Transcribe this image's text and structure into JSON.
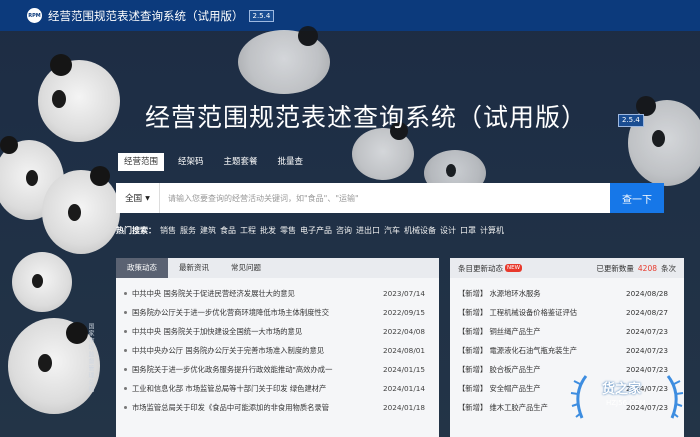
{
  "header": {
    "logo_text": "RPM",
    "title": "经营范围规范表述查询系统（试用版）",
    "version": "2.5.4"
  },
  "hero": {
    "title": "经营范围规范表述查询系统（试用版）",
    "version": "2.5.4"
  },
  "tabs": [
    {
      "label": "经营范围",
      "active": true
    },
    {
      "label": "经架码",
      "active": false
    },
    {
      "label": "主题套餐",
      "active": false
    },
    {
      "label": "批量查",
      "active": false
    }
  ],
  "search": {
    "scope_label": "全国",
    "placeholder": "请输入您要查询的经营活动关键词，如\"食品\"、\"运输\"",
    "button_label": "查一下"
  },
  "hot": {
    "label": "热门搜索：",
    "words": [
      "销售",
      "服务",
      "建筑",
      "食品",
      "工程",
      "批发",
      "零售",
      "电子产品",
      "咨询",
      "进出口",
      "汽车",
      "机械设备",
      "设计",
      "口罩",
      "计算机"
    ]
  },
  "news_panel": {
    "tabs": [
      {
        "label": "政策动态",
        "active": true
      },
      {
        "label": "最新资讯",
        "active": false
      },
      {
        "label": "常见问题",
        "active": false
      }
    ],
    "items": [
      {
        "title": "中共中央 国务院关于促进民营经济发展壮大的意见",
        "date": "2023/07/14"
      },
      {
        "title": "国务院办公厅关于进一步优化营商环境降低市场主体制度性交",
        "date": "2022/09/15"
      },
      {
        "title": "中共中央 国务院关于加快建设全国统一大市场的意见",
        "date": "2022/04/08"
      },
      {
        "title": "中共中央办公厅 国务院办公厅关于完善市场准入制度的意见",
        "date": "2024/08/01"
      },
      {
        "title": "国务院关于进一步优化政务服务提升行政效能推动\"高效办成一",
        "date": "2024/01/15"
      },
      {
        "title": "工业和信息化部 市场监管总局等十部门关于印发 绿色建材产",
        "date": "2024/01/14"
      },
      {
        "title": "市场监管总局关于印发《食品中可能添加的非食用物质名录管",
        "date": "2024/01/18"
      }
    ]
  },
  "updates_panel": {
    "title": "条目更新动态",
    "badge": "NEW",
    "count_label": "已更新数量",
    "count": "4208",
    "count_unit": "条次",
    "items": [
      {
        "title": "【新增】 水源地环水服务",
        "date": "2024/08/28"
      },
      {
        "title": "【新增】 工程机械设备价格鉴证评估",
        "date": "2024/08/27"
      },
      {
        "title": "【新增】 铜丝绳产品生产",
        "date": "2024/07/23"
      },
      {
        "title": "【新增】 電源液化石油气瓶充装生产",
        "date": "2024/07/23"
      },
      {
        "title": "【新增】 胶合板产品生产",
        "date": "2024/07/23"
      },
      {
        "title": "【新增】 安全帽产品生产",
        "date": "2024/07/23"
      },
      {
        "title": "【新增】 维木工胶产品生产",
        "date": "2024/07/23"
      }
    ]
  },
  "side_vertical_text": "国家市场监督管理总局",
  "watermark": {
    "main": "货之家",
    "sub": "HZJ56.COM"
  },
  "colors": {
    "topbar": "#0c3a7c",
    "accent": "#1677e8",
    "highlight": "#e8392c"
  }
}
